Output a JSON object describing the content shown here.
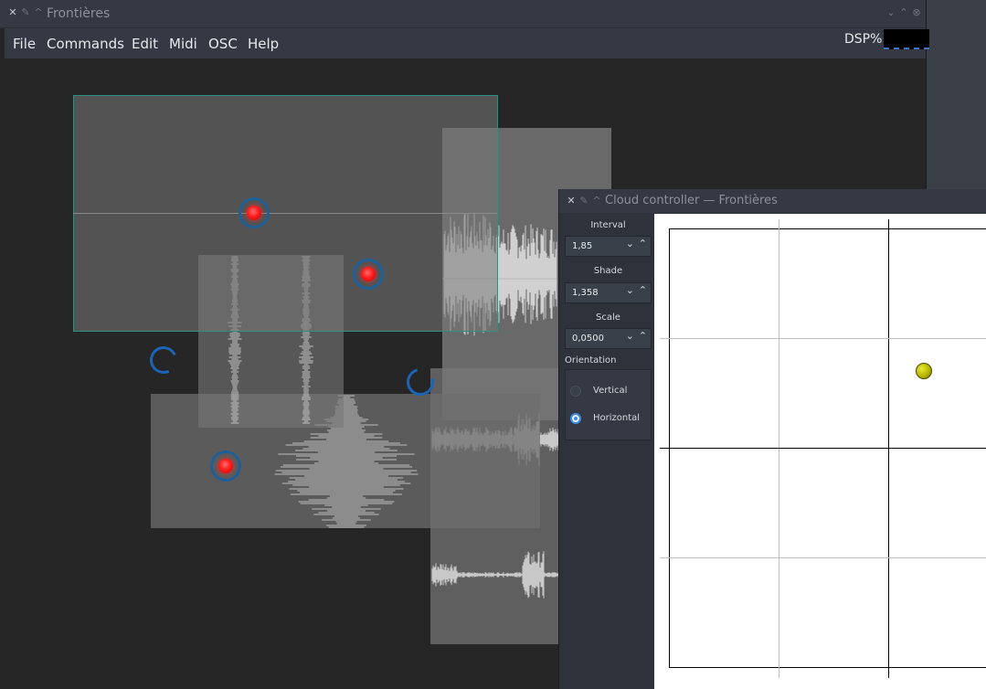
{
  "main_window": {
    "title": "Frontières",
    "menu": [
      "File",
      "Commands",
      "Edit",
      "Midi",
      "OSC",
      "Help"
    ],
    "dsp_label": "DSP%"
  },
  "cloud_controller": {
    "title": "Cloud controller — Frontières",
    "interval": {
      "label": "Interval",
      "value": "1,85"
    },
    "shade": {
      "label": "Shade",
      "value": "1,358"
    },
    "scale": {
      "label": "Scale",
      "value": "0,0500"
    },
    "orientation": {
      "label": "Orientation",
      "options": [
        "Vertical",
        "Horizontal"
      ],
      "selected": "Horizontal"
    }
  },
  "icons": {
    "close": "✕",
    "pin": "✎",
    "keep_above": "^",
    "minimize": "⌄",
    "maximize": "⌃",
    "window_close": "⊗",
    "spin_down": "⌄",
    "spin_up": "⌃"
  },
  "colors": {
    "selection_border": "#2e8f84",
    "cloud_ring": "#1f5f97",
    "cloud_center": "#ff1d1d",
    "radio_accent": "#3d8ee6",
    "puck": "#b8b400"
  }
}
